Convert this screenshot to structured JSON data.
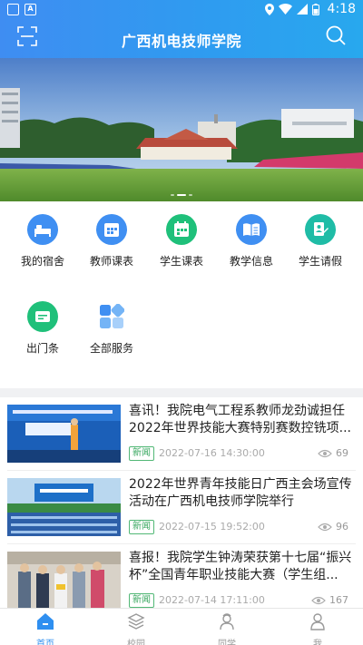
{
  "status_bar": {
    "time": "4:18"
  },
  "header": {
    "title": "广西机电技师学院"
  },
  "services": [
    {
      "label": "我的宿舍",
      "icon": "dorm-icon",
      "color": "#3f8ff2"
    },
    {
      "label": "教师课表",
      "icon": "teacher-schedule-icon",
      "color": "#3f8ff2"
    },
    {
      "label": "学生课表",
      "icon": "student-schedule-icon",
      "color": "#1fc07a"
    },
    {
      "label": "教学信息",
      "icon": "teaching-info-icon",
      "color": "#3f8ff2"
    },
    {
      "label": "学生请假",
      "icon": "student-leave-icon",
      "color": "#1fbca6"
    },
    {
      "label": "出门条",
      "icon": "exit-pass-icon",
      "color": "#1fc07a"
    },
    {
      "label": "全部服务",
      "icon": "all-services-icon",
      "color": "#3f8ff2"
    }
  ],
  "news": [
    {
      "title": "喜讯！我院电气工程系教师龙劲诚担任2022年世界技能大赛特别赛数控铣项...",
      "tag": "新闻",
      "date": "2022-07-16 14:30:00",
      "views": "69"
    },
    {
      "title": "2022年世界青年技能日广西主会场宣传活动在广西机电技师学院举行",
      "tag": "新闻",
      "date": "2022-07-15 19:52:00",
      "views": "96"
    },
    {
      "title": "喜报！我院学生钟涛荣获第十七届“振兴杯”全国青年职业技能大赛（学生组...",
      "tag": "新闻",
      "date": "2022-07-14 17:11:00",
      "views": "167"
    }
  ],
  "tabs": [
    {
      "label": "首页",
      "icon": "home-icon",
      "active": true
    },
    {
      "label": "校园",
      "icon": "campus-icon",
      "active": false
    },
    {
      "label": "同学",
      "icon": "classmates-icon",
      "active": false
    },
    {
      "label": "我",
      "icon": "profile-icon",
      "active": false
    }
  ],
  "colors": {
    "primary": "#2f8ff0",
    "tag_green": "#3aa861"
  }
}
